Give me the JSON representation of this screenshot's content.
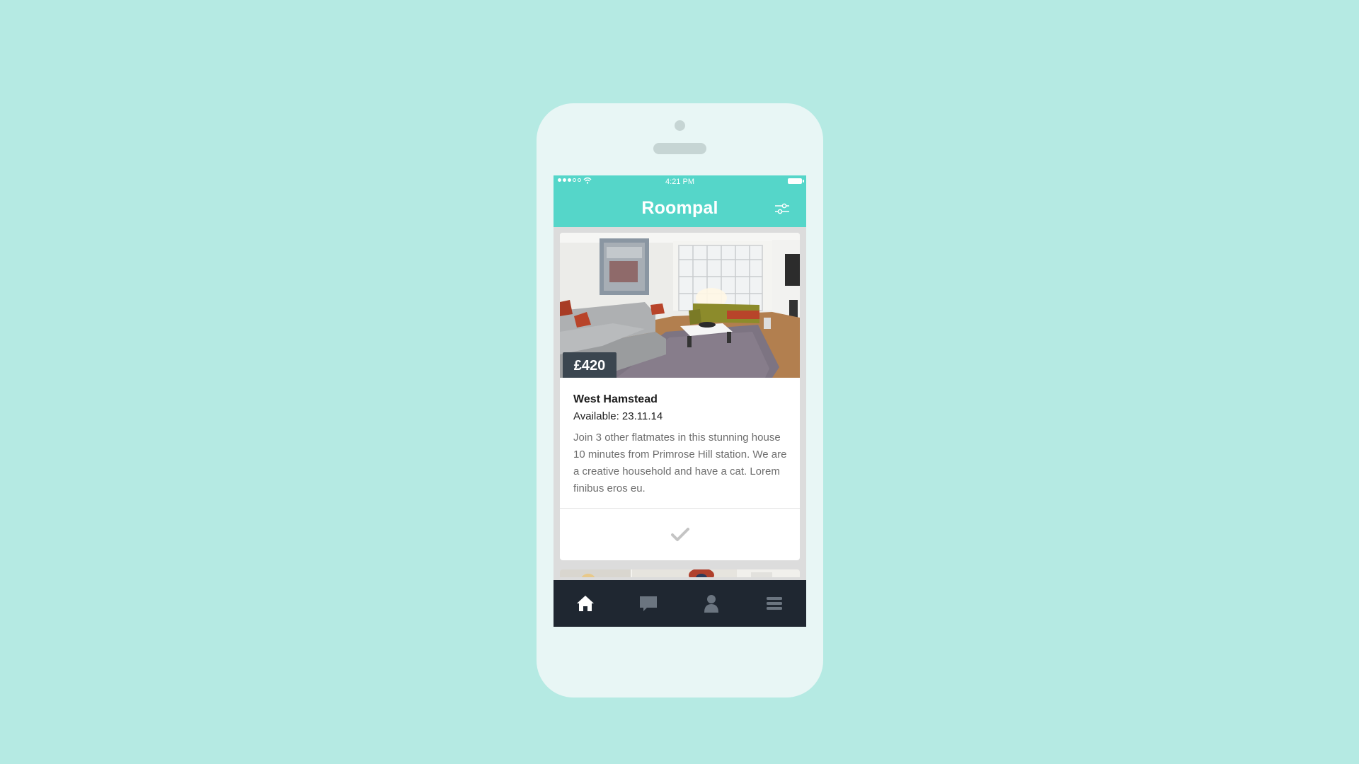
{
  "statusbar": {
    "time": "4:21 PM",
    "signal_bars": 5,
    "signal_filled": 3
  },
  "header": {
    "title": "Roompal",
    "filter_icon": "sliders-icon"
  },
  "listing": {
    "price": "£420",
    "location": "West Hamstead",
    "available": "Available: 23.11.14",
    "description": "Join 3 other flatmates in this stunning house 10 minutes from Primrose Hill station. We are a creative household and have a cat. Lorem finibus eros eu.",
    "action_icon": "checkmark-icon"
  },
  "tabs": [
    {
      "icon": "home-icon",
      "active": true
    },
    {
      "icon": "chat-icon",
      "active": false
    },
    {
      "icon": "profile-icon",
      "active": false
    },
    {
      "icon": "menu-icon",
      "active": false
    }
  ],
  "colors": {
    "background": "#b5eae3",
    "accent": "#55d6c9",
    "tabbar": "#1f2731",
    "price_badge": "#3b4650"
  }
}
